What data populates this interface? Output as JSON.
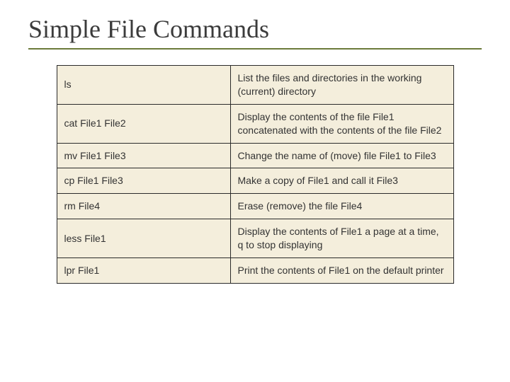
{
  "title": "Simple File Commands",
  "rows": [
    {
      "cmd": "ls",
      "desc": "List the files and directories in the working (current) directory"
    },
    {
      "cmd": "cat File1 File2",
      "desc": "Display the contents of the file File1 concatenated with the contents of the file File2"
    },
    {
      "cmd": "mv File1 File3",
      "desc": "Change the name of (move) file File1 to File3"
    },
    {
      "cmd": "cp File1 File3",
      "desc": "Make a copy of File1 and call it File3"
    },
    {
      "cmd": "rm File4",
      "desc": "Erase (remove) the file File4"
    },
    {
      "cmd": "less File1",
      "desc": "Display the contents of File1 a page at a time, q to stop displaying"
    },
    {
      "cmd": "lpr File1",
      "desc": "Print the contents of File1 on the default printer"
    }
  ]
}
